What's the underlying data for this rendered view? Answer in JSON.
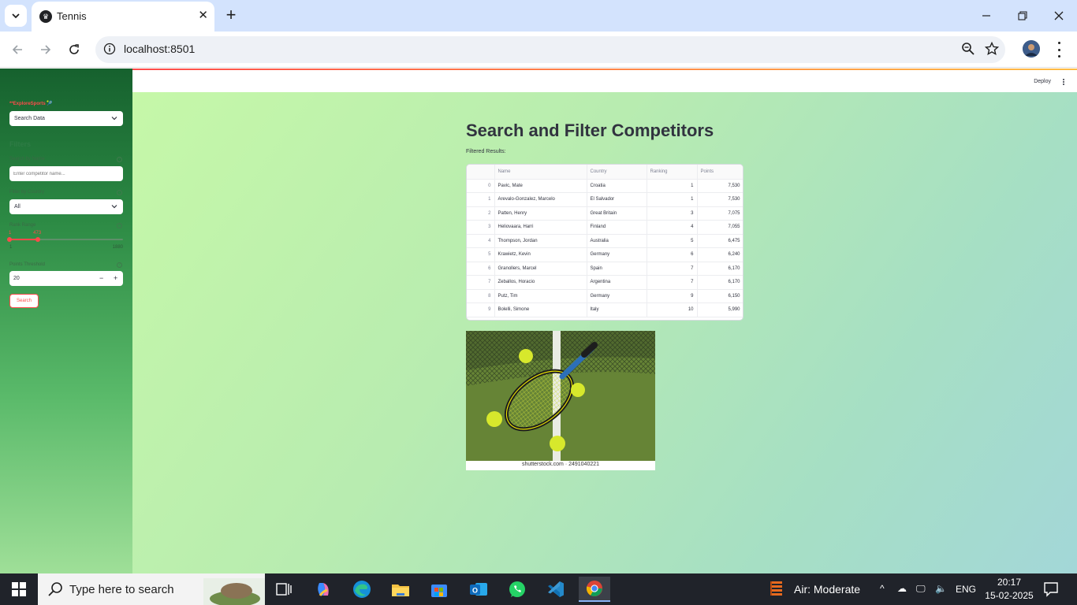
{
  "browser": {
    "tab_title": "Tennis",
    "url": "localhost:8501"
  },
  "header": {
    "deploy_label": "Deploy"
  },
  "sidebar": {
    "nav_label": "**ExploreSports",
    "nav_emoji": "🎾",
    "nav_select_value": "Search Data",
    "filters_heading": "Filters",
    "search_label": "Search by Name",
    "search_placeholder": "Enter competitor name...",
    "country_label": "Filter by Country",
    "country_value": "All",
    "rank_label": "Rank Range",
    "rank_low": "1",
    "rank_high": "473",
    "rank_min": "1",
    "rank_max": "1880",
    "rank_low_fraction": 0.0,
    "rank_high_fraction": 0.251,
    "points_label": "Points Threshold",
    "points_value": "20",
    "search_button": "Search"
  },
  "main": {
    "title": "Search and Filter Competitors",
    "results_label": "Filtered Results:",
    "columns": [
      "",
      "Name",
      "Country",
      "Ranking",
      "Points"
    ],
    "rows": [
      {
        "idx": "0",
        "name": "Pavic, Mate",
        "country": "Croatia",
        "ranking": "1",
        "points": "7,530"
      },
      {
        "idx": "1",
        "name": "Arevalo-Gonzalez, Marcelo",
        "country": "El Salvador",
        "ranking": "1",
        "points": "7,530"
      },
      {
        "idx": "2",
        "name": "Patten, Henry",
        "country": "Great Britain",
        "ranking": "3",
        "points": "7,075"
      },
      {
        "idx": "3",
        "name": "Heliovaara, Harri",
        "country": "Finland",
        "ranking": "4",
        "points": "7,055"
      },
      {
        "idx": "4",
        "name": "Thompson, Jordan",
        "country": "Australia",
        "ranking": "5",
        "points": "6,475"
      },
      {
        "idx": "5",
        "name": "Krawietz, Kevin",
        "country": "Germany",
        "ranking": "6",
        "points": "6,240"
      },
      {
        "idx": "6",
        "name": "Granollers, Marcel",
        "country": "Spain",
        "ranking": "7",
        "points": "6,170"
      },
      {
        "idx": "7",
        "name": "Zeballos, Horacio",
        "country": "Argentina",
        "ranking": "7",
        "points": "6,170"
      },
      {
        "idx": "8",
        "name": "Putz, Tim",
        "country": "Germany",
        "ranking": "9",
        "points": "6,150"
      },
      {
        "idx": "9",
        "name": "Bolelli, Simone",
        "country": "Italy",
        "ranking": "10",
        "points": "5,990"
      }
    ],
    "image_caption": "shutterstock.com · 2491040221"
  },
  "taskbar": {
    "search_placeholder": "Type here to search",
    "air_quality": "Air: Moderate",
    "language": "ENG",
    "time": "20:17",
    "date": "15-02-2025"
  }
}
